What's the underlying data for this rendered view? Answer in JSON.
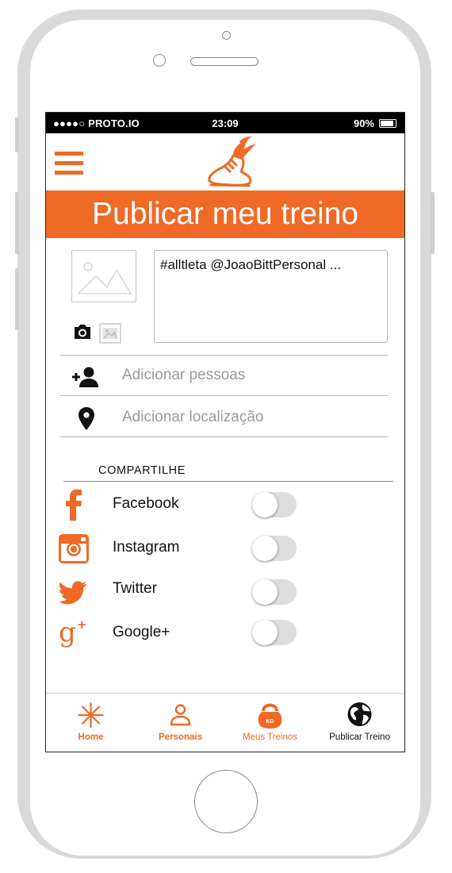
{
  "status_bar": {
    "carrier": "●●●●○ PROTO.IO",
    "time": "23:09",
    "battery": "90%"
  },
  "header": {
    "menu_icon": "hamburger-icon",
    "logo_icon": "winged-shoe-logo"
  },
  "page_title": "Publicar meu treino",
  "post": {
    "caption": "#alltleta @JoaoBittPersonal ...",
    "camera_icon": "camera-icon",
    "gallery_icon": "gallery-icon"
  },
  "options": {
    "add_people": "Adicionar pessoas",
    "add_location": "Adicionar localização"
  },
  "share": {
    "heading": "COMPARTILHE",
    "networks": [
      {
        "label": "Facebook",
        "icon": "facebook-icon",
        "enabled": false
      },
      {
        "label": "Instagram",
        "icon": "instagram-icon",
        "enabled": false
      },
      {
        "label": "Twitter",
        "icon": "twitter-icon",
        "enabled": false
      },
      {
        "label": "Google+",
        "icon": "google-plus-icon",
        "enabled": false
      }
    ]
  },
  "tabs": [
    {
      "label": "Home",
      "icon": "star-burst-icon"
    },
    {
      "label": "Personais",
      "icon": "person-icon"
    },
    {
      "label": "Meus Treinos",
      "icon": "kettlebell-icon"
    },
    {
      "label": "Publicar Treino",
      "icon": "globe-icon"
    }
  ],
  "colors": {
    "accent": "#ef6a26",
    "text": "#111111",
    "placeholder": "#9a9a9a"
  }
}
